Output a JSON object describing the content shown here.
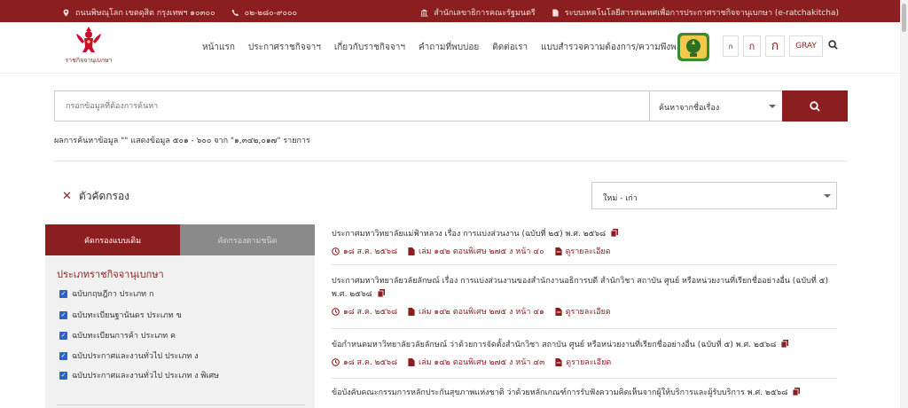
{
  "topbar": {
    "address": "ถนนพิษณุโลก เขตดุสิต กรุงเทพฯ ๑๐๓๐๐",
    "phone": "๐๒-๒๘๐-๙๐๐๐",
    "link1": "สำนักเลขาธิการคณะรัฐมนตรี",
    "link2": "ระบบเทคโนโลยีสารสนเทศเพื่อการประกาศราชกิจจานุเบกษา (e-ratchakitcha)"
  },
  "header": {
    "logo_text": "ราชกิจจานุเบกษา",
    "nav": [
      "หน้าแรก",
      "ประกาศราชกิจจาฯ",
      "เกี่ยวกับราชกิจจาฯ",
      "คำถามที่พบบ่อย",
      "ติดต่อเรา",
      "แบบสำรวจความต้องการ/ความพึงพอใจ"
    ],
    "font_small": "ก",
    "font_medium": "ก",
    "font_large": "ก",
    "gray_label": "GRAY"
  },
  "search": {
    "placeholder": "กรอกข้อมูลที่ต้องการค้นหา",
    "select_value": "ค้นหาจากชื่อเรื่อง"
  },
  "result_info": "ผลการค้นหาข้อมูล \"\" แสดงข้อมูล ๕๐๑ - ๖๐๐ จาก \"๑,๓๔๒,๐๑๗\" รายการ",
  "filter": {
    "heading": "ตัวคัดกรอง",
    "sort_value": "ใหม่ - เก่า",
    "tab_active": "คัดกรองแบบเดิม",
    "tab_inactive": "คัดกรองตามชนิด",
    "category_title": "ประเภทราชกิจจานุเบกษา",
    "options": [
      "ฉบับกฤษฎีกา ประเภท ก",
      "ฉบับทะเบียนฐานันดร ประเภท ข",
      "ฉบับทะเบียนการค้า ประเภท ค",
      "ฉบับประกาศและงานทั่วไป ประเภท ง",
      "ฉบับประกาศและงานทั่วไป ประเภท ง พิเศษ"
    ]
  },
  "results": [
    {
      "title": "ประกาศมหาวิทยาลัยแม่ฟ้าหลวง เรื่อง การแบ่งส่วนงาน (ฉบับที่ ๒๕) พ.ศ. ๒๕๖๘",
      "date": "๑๘ ส.ค. ๒๕๖๘",
      "volume": "เล่ม ๑๔๒ ตอนพิเศษ ๒๗๕ ง หน้า ๔๐",
      "detail": "ดูรายละเอียด"
    },
    {
      "title": "ประกาศมหาวิทยาลัยวลัยลักษณ์ เรื่อง การแบ่งส่วนงานของสำนักงานอธิการบดี สำนักวิชา สถาบัน ศูนย์ หรือหน่วยงานที่เรียกชื่ออย่างอื่น (ฉบับที่ ๕) พ.ศ. ๒๕๖๘",
      "date": "๑๘ ส.ค. ๒๕๖๘",
      "volume": "เล่ม ๑๔๒ ตอนพิเศษ ๒๗๕ ง หน้า ๔๑",
      "detail": "ดูรายละเอียด"
    },
    {
      "title": "ข้อกำหนดมหาวิทยาลัยวลัยลักษณ์ ว่าด้วยการจัดตั้งสำนักวิชา สถาบัน ศูนย์ หรือหน่วยงานที่เรียกชื่ออย่างอื่น (ฉบับที่ ๕) พ.ศ. ๒๕๖๘",
      "date": "๑๘ ส.ค. ๒๕๖๘",
      "volume": "เล่ม ๑๔๒ ตอนพิเศษ ๒๗๕ ง หน้า ๔๓",
      "detail": "ดูรายละเอียด"
    },
    {
      "title": "ข้อบังคับคณะกรรมการหลักประกันสุขภาพแห่งชาติ ว่าด้วยหลักเกณฑ์การรับฟังความคิดเห็นจากผู้ให้บริการและผู้รับบริการ พ.ศ. ๒๕๖๘"
    }
  ],
  "colors": {
    "brand": "#8b1e1e",
    "checkbox": "#2b63c6"
  }
}
